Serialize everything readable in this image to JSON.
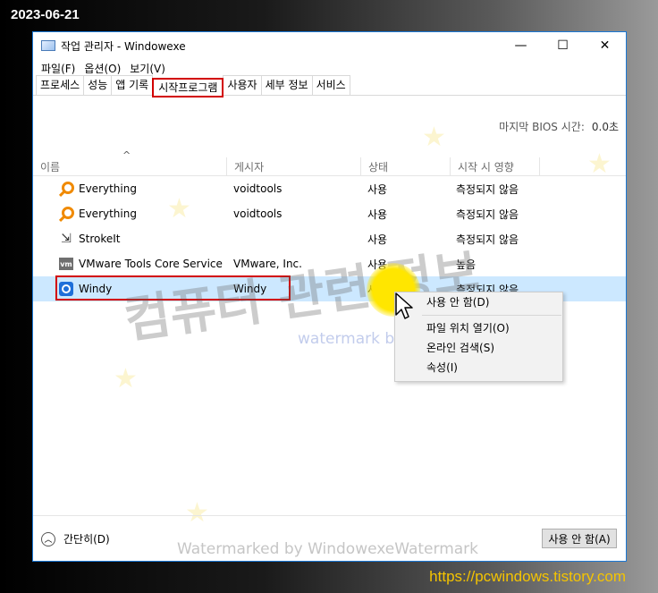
{
  "date_stamp": "2023-06-21",
  "site_url": "https://pcwindows.tistory.com",
  "window": {
    "title": "작업 관리자  - Windowexe",
    "minimize": "—",
    "maximize": "☐",
    "close": "✕"
  },
  "menu": [
    "파일(F)",
    "옵션(O)",
    "보기(V)"
  ],
  "tabs": [
    "프로세스",
    "성능",
    "앱 기록",
    "시작프로그램",
    "사용자",
    "세부 정보",
    "서비스"
  ],
  "bios": {
    "label": "마지막 BIOS 시간:",
    "value": "0.0초"
  },
  "sort_arrow": "^",
  "columns": [
    "이름",
    "게시자",
    "상태",
    "시작 시 영향"
  ],
  "rows": [
    {
      "icon": "search-icon",
      "name": "Everything",
      "publisher": "voidtools",
      "status": "사용",
      "impact": "측정되지 않음"
    },
    {
      "icon": "search-icon",
      "name": "Everything",
      "publisher": "voidtools",
      "status": "사용",
      "impact": "측정되지 않음"
    },
    {
      "icon": "strokeit-icon",
      "name": "StrokeIt",
      "publisher": "",
      "status": "사용",
      "impact": "측정되지 않음"
    },
    {
      "icon": "vmware-icon",
      "name": "VMware Tools Core Service",
      "publisher": "VMware, Inc.",
      "status": "사용",
      "impact": "높음"
    },
    {
      "icon": "windy-icon",
      "name": "Windy",
      "publisher": "Windy",
      "status": "사용",
      "impact": "측정되지 않음"
    }
  ],
  "context_menu": [
    "사용 안 함(D)",
    "파일 위치 열기(O)",
    "온라인 검색(S)",
    "속성(I)"
  ],
  "watermarks": {
    "big": "컴퓨터 관련 정보",
    "blue": "watermark by windowexe",
    "bottom": "Watermarked by WindowexeWatermark"
  },
  "footer": {
    "collapse_label": "간단히(D)",
    "collapse_icon": "chevron-up-icon",
    "disable_button": "사용 안 함(A)"
  },
  "colors": {
    "accent": "#1a78d6",
    "highlight_box": "#d20000",
    "selection": "#cce8ff",
    "url": "#f5c400"
  }
}
